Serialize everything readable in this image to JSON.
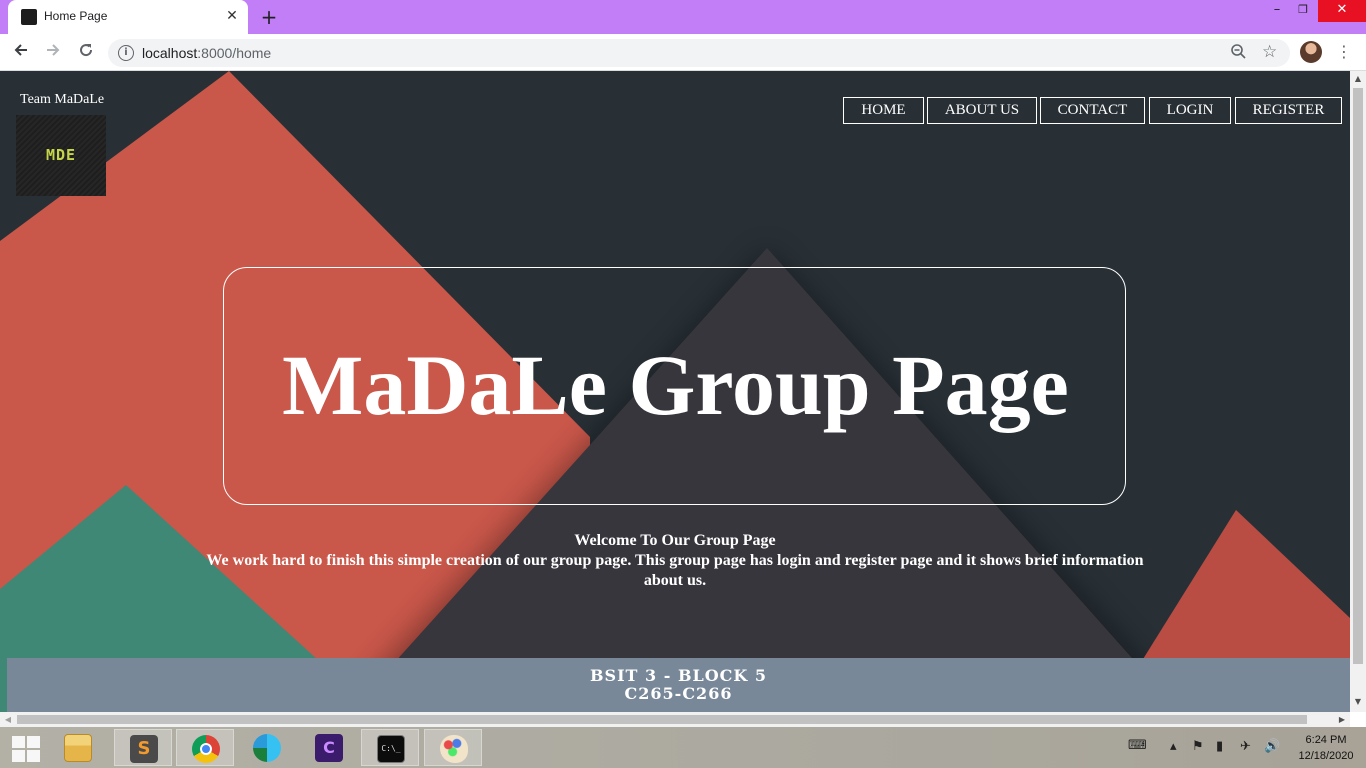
{
  "browser": {
    "tab_title": "Home Page",
    "tab_close": "✕",
    "new_tab": "+",
    "url_host": "localhost",
    "url_rest": ":8000/home",
    "window_controls": {
      "minimize": "–",
      "restore": "❐",
      "close": "✕"
    },
    "icons": [
      "back-icon",
      "forward-icon",
      "reload-icon",
      "info-icon",
      "zoom-icon",
      "star-icon",
      "profile-avatar",
      "menu-icon"
    ]
  },
  "page": {
    "team_label": "Team MaDaLe",
    "logo_text": "MDE",
    "nav": [
      {
        "label": "HOME"
      },
      {
        "label": "ABOUT US"
      },
      {
        "label": "CONTACT"
      },
      {
        "label": "LOGIN"
      },
      {
        "label": "REGISTER"
      }
    ],
    "hero_title": "MaDaLe Group Page",
    "welcome_heading": "Welcome To Our Group Page",
    "welcome_text": "We work hard to finish this simple creation of our group page. This group page has login and register page and it shows brief information about us.",
    "footer_line1": "BSIT 3 - BLOCK 5",
    "footer_line2": "C265-C266",
    "colors": {
      "background": "#283036",
      "red_mountain": "#c9574a",
      "dark_mountain": "#38363d",
      "green_mountain": "#3f8876",
      "footer": "#788899"
    }
  },
  "taskbar": {
    "apps": [
      "file-explorer",
      "sublime-text",
      "chrome",
      "edge",
      "media-app",
      "command-prompt",
      "paint"
    ],
    "time": "6:24 PM",
    "date": "12/18/2020"
  }
}
